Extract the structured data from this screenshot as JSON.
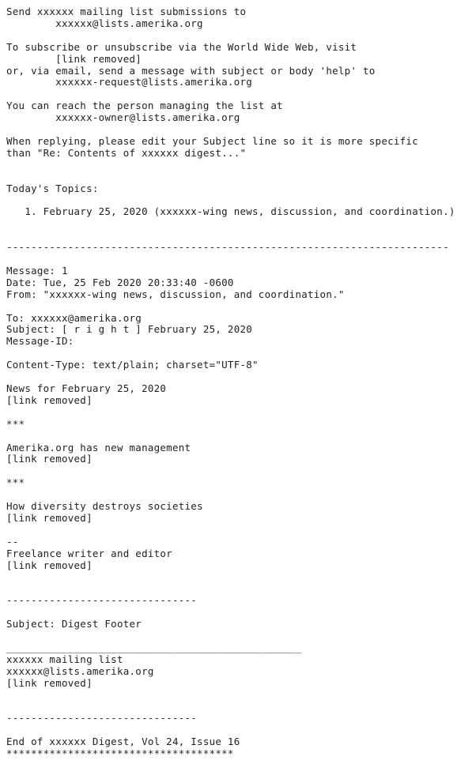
{
  "document": {
    "kind": "plain-text-email-digest",
    "background_color": "#ffffff",
    "text_color": "#1e1e1e",
    "lines": [
      "Send xxxxxx mailing list submissions to",
      "        xxxxxx@lists.amerika.org",
      "",
      "To subscribe or unsubscribe via the World Wide Web, visit",
      "        [link removed]",
      "or, via email, send a message with subject or body 'help' to",
      "        xxxxxx-request@lists.amerika.org",
      "",
      "You can reach the person managing the list at",
      "        xxxxxx-owner@lists.amerika.org",
      "",
      "When replying, please edit your Subject line so it is more specific",
      "than \"Re: Contents of xxxxxx digest...\"",
      "",
      "",
      "Today's Topics:",
      "",
      "   1. February 25, 2020 (xxxxxx-wing news, discussion, and coordination.)",
      "",
      "",
      "------------------------------------------------------------------------",
      "",
      "Message: 1",
      "Date: Tue, 25 Feb 2020 20:33:40 -0600",
      "From: \"xxxxxx-wing news, discussion, and coordination.\"",
      "",
      "To: xxxxxx@amerika.org",
      "Subject: [ r i g h t ] February 25, 2020",
      "Message-ID:",
      "",
      "Content-Type: text/plain; charset=\"UTF-8\"",
      "",
      "News for February 25, 2020",
      "[link removed]",
      "",
      "***",
      "",
      "Amerika.org has new management",
      "[link removed]",
      "",
      "***",
      "",
      "How diversity destroys societies",
      "[link removed]",
      "",
      "--",
      "Freelance writer and editor",
      "[link removed]",
      "",
      "",
      "-------------------------------",
      "",
      "Subject: Digest Footer",
      "",
      "________________________________________________",
      "xxxxxx mailing list",
      "xxxxxx@lists.amerika.org",
      "[link removed]",
      "",
      "",
      "-------------------------------",
      "",
      "End of xxxxxx Digest, Vol 24, Issue 16",
      "*************************************"
    ]
  }
}
